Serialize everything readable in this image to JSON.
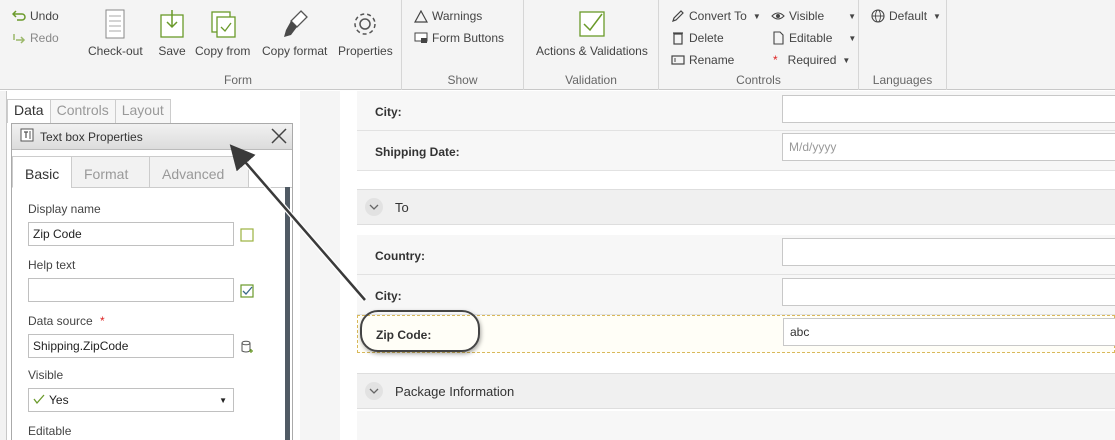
{
  "ribbon": {
    "undo": "Undo",
    "redo": "Redo",
    "form_group": {
      "label": "Form",
      "buttons": [
        "Check-out",
        "Save",
        "Copy from",
        "Copy format",
        "Properties"
      ]
    },
    "show_group": {
      "label": "Show",
      "warnings": "Warnings",
      "form_buttons": "Form Buttons"
    },
    "validation_group": {
      "label": "Validation",
      "actions": "Actions & Validations"
    },
    "controls_group": {
      "label": "Controls",
      "convert_to": "Convert To",
      "delete": "Delete",
      "rename": "Rename",
      "visible": "Visible",
      "editable": "Editable",
      "required": "Required"
    },
    "languages_group": {
      "label": "Languages",
      "default": "Default"
    }
  },
  "left_panel": {
    "tabs": [
      "Data",
      "Controls",
      "Layout"
    ],
    "active_tab": "Data",
    "properties_title": "Text box Properties",
    "sub_tabs": [
      "Basic",
      "Format",
      "Advanced"
    ],
    "fields": {
      "display_name_label": "Display name",
      "display_name_value": "Zip Code",
      "help_text_label": "Help text",
      "help_text_value": "",
      "data_source_label": "Data source",
      "data_source_value": "Shipping.ZipCode",
      "visible_label": "Visible",
      "visible_value": "Yes",
      "editable_label": "Editable"
    }
  },
  "form": {
    "rows_top": [
      {
        "label": "City:",
        "value": ""
      },
      {
        "label": "Shipping Date:",
        "placeholder": "M/d/yyyy"
      }
    ],
    "section_to": "To",
    "rows_to": [
      {
        "label": "Country:",
        "value": ""
      },
      {
        "label": "City:",
        "value": ""
      },
      {
        "label": "Zip Code:",
        "value": "abc"
      }
    ],
    "section_package": "Package Information"
  },
  "colors": {
    "accent_green": "#6a9a2a",
    "required_red": "#d22222",
    "scrollbar": "#505a64"
  }
}
